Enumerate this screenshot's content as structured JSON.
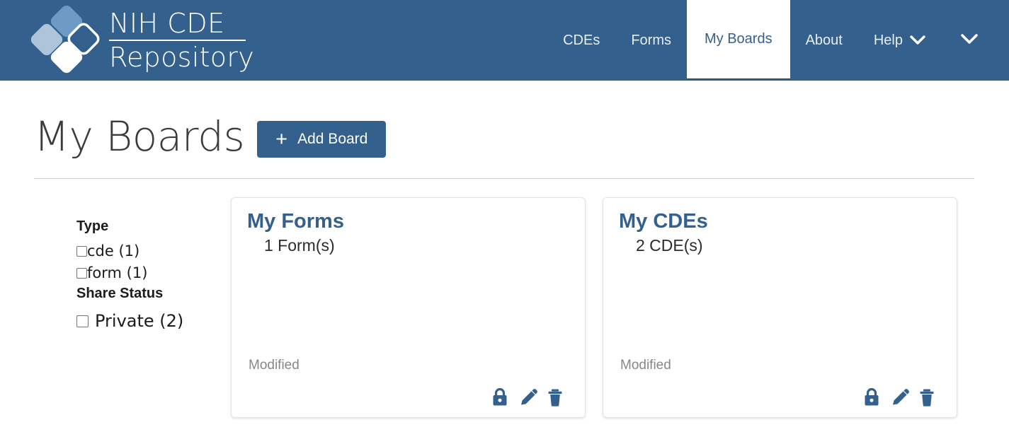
{
  "brand": {
    "line1": "NIH CDE",
    "line2": "Repository",
    "logo_icon": "nih-cde-diamonds-logo"
  },
  "nav": {
    "items": [
      {
        "label": "CDEs",
        "active": false,
        "has_caret": false
      },
      {
        "label": "Forms",
        "active": false,
        "has_caret": false
      },
      {
        "label": "My Boards",
        "active": true,
        "has_caret": false
      },
      {
        "label": "About",
        "active": false,
        "has_caret": false
      },
      {
        "label": "Help",
        "active": false,
        "has_caret": true
      }
    ],
    "user_menu_icon": "chevron-down-icon"
  },
  "page": {
    "title": "My Boards",
    "add_board_label": "Add Board",
    "add_board_plus": "+"
  },
  "filters": {
    "type_heading": "Type",
    "type_options": [
      {
        "label": "cde (1)",
        "checked": false
      },
      {
        "label": "form (1)",
        "checked": false
      }
    ],
    "share_status_heading": "Share Status",
    "share_status_options": [
      {
        "label": "Private (2)",
        "checked": false
      }
    ]
  },
  "boards": [
    {
      "name": "My Forms",
      "count_label": "1 Form(s)",
      "modified_label": "Modified",
      "actions": [
        {
          "icon": "lock-icon",
          "name": "privacy-lock-button"
        },
        {
          "icon": "pencil-icon",
          "name": "edit-board-button"
        },
        {
          "icon": "trash-icon",
          "name": "delete-board-button"
        }
      ]
    },
    {
      "name": "My CDEs",
      "count_label": "2 CDE(s)",
      "modified_label": "Modified",
      "actions": [
        {
          "icon": "lock-icon",
          "name": "privacy-lock-button"
        },
        {
          "icon": "pencil-icon",
          "name": "edit-board-button"
        },
        {
          "icon": "trash-icon",
          "name": "delete-board-button"
        }
      ]
    }
  ],
  "colors": {
    "header_blue": "#33608C",
    "accent_blue": "#33608C",
    "title_gray": "#3c3c3c",
    "muted_gray": "#878787"
  }
}
